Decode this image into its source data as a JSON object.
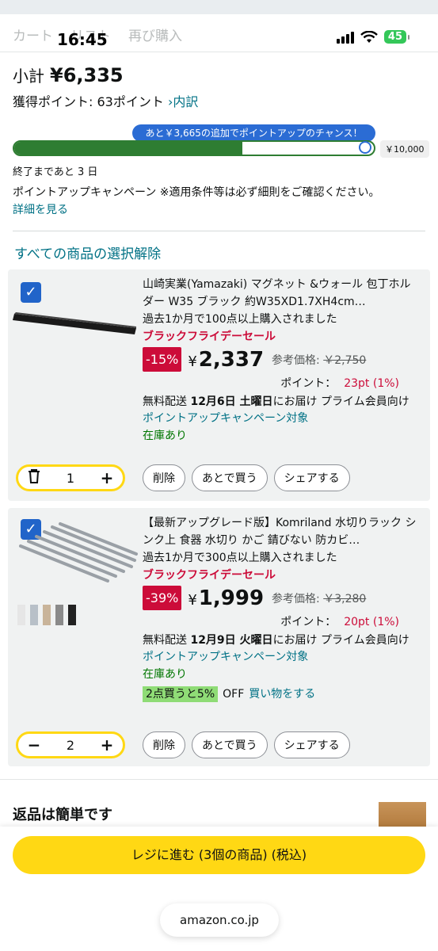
{
  "status_bar": {
    "time": "16:45",
    "battery": "45"
  },
  "ghost_nav": [
    "カート",
    "リスト",
    "再び購入"
  ],
  "summary": {
    "subtotal_label": "小計",
    "subtotal_value": "¥6,335",
    "points_label": "獲得ポイント: 63ポイント",
    "breakdown_link": "›内訳"
  },
  "points_progress": {
    "callout": "あと￥3,665の追加でポイントアップのチャンス！",
    "progress": 0.634,
    "max_label": "￥10,000",
    "ends_in": "終了まであと 3 日",
    "campaign_text": "ポイントアップキャンペーン ※適用条件等は必ず細則をご確認ください。",
    "details_link": "詳細を見る"
  },
  "deselect_all": "すべての商品の選択解除",
  "items": [
    {
      "title": "山崎実業(Yamazaki) マグネット &ウォール 包丁ホルダー W35 ブラック 約W35XD1.7XH4cm…",
      "bought": "過去1か月で100点以上購入されました",
      "sale_label": "ブラックフライデーセール",
      "discount": "-15%",
      "price": "2,337",
      "ref_label": "参考価格:",
      "ref_price": "￥2,750",
      "points_label": "ポイント：",
      "points_value": "23pt (1%)",
      "delivery_prefix": "無料配送",
      "delivery_date": "12月6日 土曜日",
      "delivery_suffix": "にお届け プライム会員向け",
      "campaign": "ポイントアップキャンペーン対象",
      "stock": "在庫あり",
      "quantity": "1",
      "qty_left_icon": "trash-icon"
    },
    {
      "title": "【最新アップグレード版】Komriland 水切りラック シンク上 食器 水切り かご 錆びない 防カビ…",
      "bought": "過去1か月で300点以上購入されました",
      "sale_label": "ブラックフライデーセール",
      "discount": "-39%",
      "price": "1,999",
      "ref_label": "参考価格:",
      "ref_price": "￥3,280",
      "points_label": "ポイント：",
      "points_value": "20pt (1%)",
      "delivery_prefix": "無料配送",
      "delivery_date": "12月9日 火曜日",
      "delivery_suffix": "にお届け プライム会員向け",
      "campaign": "ポイントアップキャンペーン対象",
      "stock": "在庫あり",
      "promo_tag": "2点買うと5%",
      "promo_off": "OFF",
      "promo_link": "買い物をする",
      "quantity": "2",
      "qty_left_icon": "minus-icon"
    }
  ],
  "actions": {
    "delete": "削除",
    "save_later": "あとで買う",
    "share": "シェアする"
  },
  "returns_title": "返品は簡単です",
  "checkout_label": "レジに進む (3個の商品) (税込)",
  "domain": "amazon.co.jp"
}
